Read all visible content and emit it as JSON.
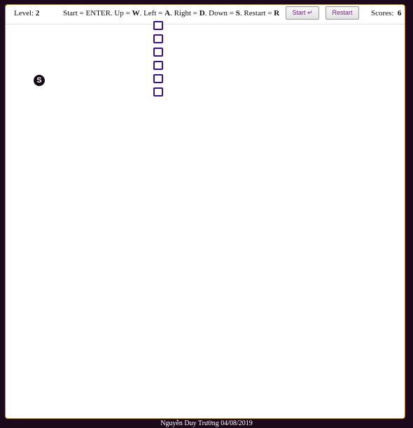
{
  "header": {
    "level_label": "Level:",
    "level_value": "2",
    "controls": {
      "start_text": "Start = ENTER. Up = ",
      "up_key": "W",
      "left_text": ". Left = ",
      "left_key": "A",
      "right_text": ". Right = ",
      "right_key": "D",
      "down_text": ". Down = ",
      "down_key": "S",
      "restart_text": ". Restart = ",
      "restart_key": "R"
    },
    "start_button_label": "Start ↵",
    "restart_button_label": "Restart",
    "scores_label": "Scores:",
    "scores_value": "6"
  },
  "game": {
    "snake_length": 6,
    "snake_direction": "vertical",
    "food_icon": "skype-icon",
    "food_glyph": "S",
    "snake_color": "#3b1287",
    "food_color": "#140a14"
  },
  "footer": {
    "credit": "Nguyễn Duy Trường 04/08/2019"
  }
}
